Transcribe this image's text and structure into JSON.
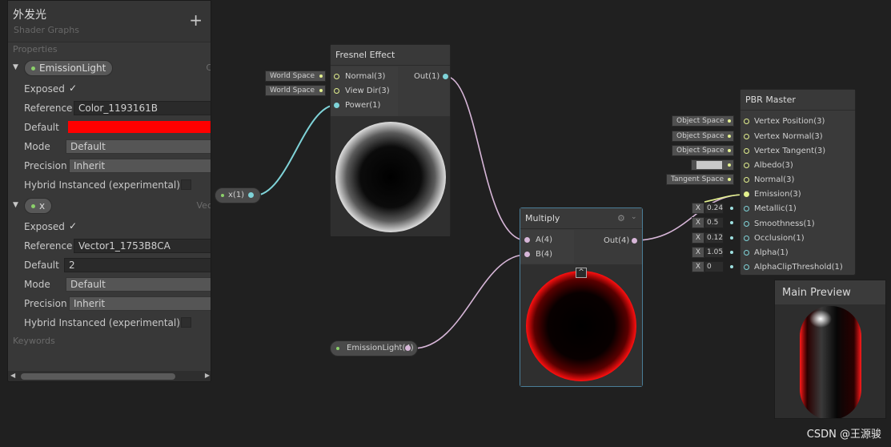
{
  "blackboard": {
    "title": "外发光",
    "subtitle": "Shader Graphs",
    "add_icon": "plus-icon",
    "properties_label": "Properties",
    "keywords_label": "Keywords",
    "properties": [
      {
        "name": "EmissionLight",
        "type_hint": "C",
        "exposed_label": "Exposed",
        "exposed": true,
        "reference_label": "Reference",
        "reference": "Color_1193161B",
        "default_label": "Default",
        "default_color": "#ff0000",
        "mode_label": "Mode",
        "mode": "Default",
        "precision_label": "Precision",
        "precision": "Inherit",
        "hybrid_label": "Hybrid Instanced (experimental)",
        "hybrid": false
      },
      {
        "name": "x",
        "type_hint": "Vec",
        "exposed_label": "Exposed",
        "exposed": true,
        "reference_label": "Reference",
        "reference": "Vector1_1753B8CA",
        "default_label": "Default",
        "default": "2",
        "mode_label": "Mode",
        "mode": "Default",
        "precision_label": "Precision",
        "precision": "Inherit",
        "hybrid_label": "Hybrid Instanced (experimental)",
        "hybrid": false
      }
    ]
  },
  "fresnel": {
    "title": "Fresnel Effect",
    "inputs": [
      "Normal(3)",
      "View Dir(3)",
      "Power(1)"
    ],
    "output": "Out(1)",
    "chips": [
      "World Space",
      "World Space"
    ]
  },
  "x_node": {
    "label": "x(1)"
  },
  "emission_node": {
    "label": "EmissionLight(4)"
  },
  "multiply": {
    "title": "Multiply",
    "inputs": [
      "A(4)",
      "B(4)"
    ],
    "output": "Out(4)",
    "gear_icon": "gear-icon",
    "collapse_icon": "chevron-up-icon"
  },
  "pbr": {
    "title": "PBR Master",
    "inputs": [
      "Vertex Position(3)",
      "Vertex Normal(3)",
      "Vertex Tangent(3)",
      "Albedo(3)",
      "Normal(3)",
      "Emission(3)",
      "Metallic(1)",
      "Smoothness(1)",
      "Occlusion(1)",
      "Alpha(1)",
      "AlphaClipThreshold(1)"
    ],
    "chips": [
      "Object Space",
      "Object Space",
      "Object Space",
      "",
      "Tangent Space"
    ],
    "x_label": "X",
    "values": [
      "0.24",
      "0.5",
      "0.12",
      "1.05",
      "0"
    ]
  },
  "preview": {
    "title": "Main Preview"
  },
  "watermark": "CSDN @王源骏",
  "colors": {
    "wire_float": "#7fd3d8",
    "wire_vec4": "#d7b6d8",
    "wire_vec3": "#e3f08e",
    "emission_red": "#ff0000"
  }
}
